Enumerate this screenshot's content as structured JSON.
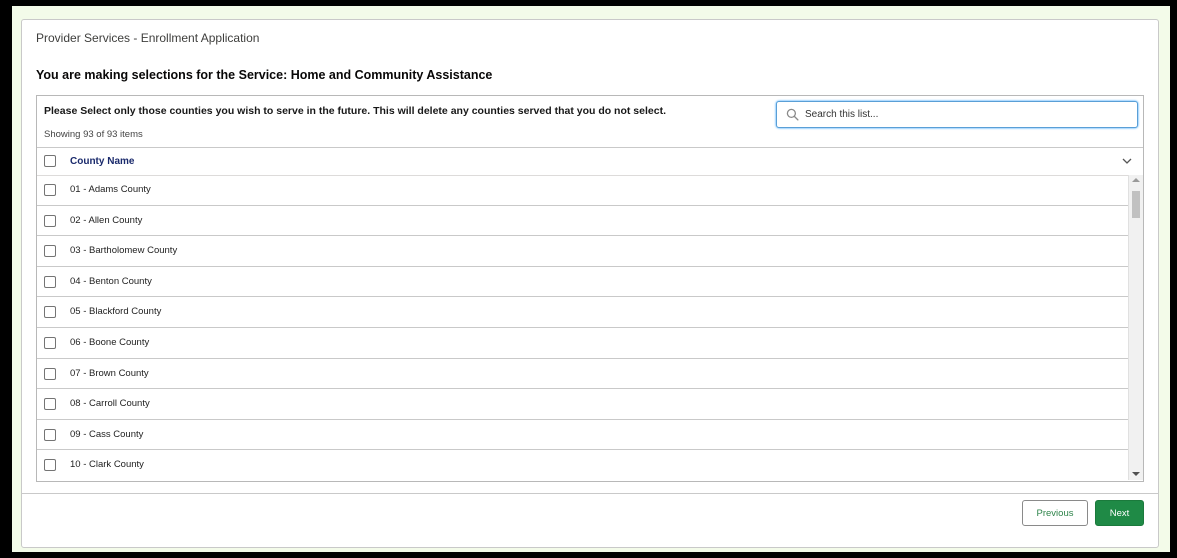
{
  "app_title": "Provider Services - Enrollment Application",
  "heading": "You are making selections for the Service: Home and Community Assistance",
  "instructions": "Please Select only those counties you wish to serve in the future. This will delete any counties served that you do not select.",
  "item_count": "Showing 93 of 93 items",
  "search": {
    "placeholder": "Search this list...",
    "value": ""
  },
  "table": {
    "column_header": "County Name",
    "rows": [
      "01 - Adams County",
      "02 - Allen County",
      "03 - Bartholomew County",
      "04 - Benton County",
      "05 - Blackford County",
      "06 - Boone County",
      "07 - Brown County",
      "08 - Carroll County",
      "09 - Cass County",
      "10 - Clark County"
    ]
  },
  "buttons": {
    "previous": "Previous",
    "next": "Next"
  },
  "colors": {
    "next_button": "#1f8a46",
    "page_background": "#f3fbe9",
    "column_header": "#1a2a6c"
  }
}
